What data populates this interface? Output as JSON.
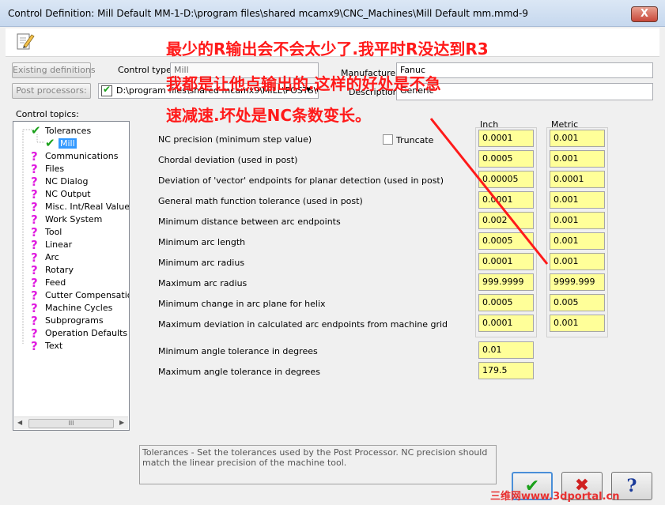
{
  "window": {
    "title": "Control Definition: Mill Default MM-1-D:\\program files\\shared mcamx9\\CNC_Machines\\Mill Default mm.mmd-9",
    "close_label": "X"
  },
  "header": {
    "existing_definitions_label": "Existing definitions",
    "post_processors_label": "Post processors:",
    "control_type_label": "Control type:",
    "control_type_value": "Mill",
    "post_path_value": "D:\\program files\\shared mcamx9\\MILL\\POSTS\\G",
    "manufacturer_label": "Manufacturer:",
    "manufacturer_value": "Fanuc",
    "description_label": "Description:",
    "description_value": "Generic"
  },
  "sidebar": {
    "title": "Control topics:",
    "items": [
      {
        "label": "Tolerances",
        "status": "check",
        "indent": 1
      },
      {
        "label": "Mill",
        "status": "check",
        "indent": 2,
        "selected": true
      },
      {
        "label": "Communications",
        "status": "question",
        "indent": 1
      },
      {
        "label": "Files",
        "status": "question",
        "indent": 1
      },
      {
        "label": "NC Dialog",
        "status": "question",
        "indent": 1
      },
      {
        "label": "NC Output",
        "status": "question",
        "indent": 1
      },
      {
        "label": "Misc. Int/Real Values",
        "status": "question",
        "indent": 1
      },
      {
        "label": "Work System",
        "status": "question",
        "indent": 1
      },
      {
        "label": "Tool",
        "status": "question",
        "indent": 1
      },
      {
        "label": "Linear",
        "status": "question",
        "indent": 1
      },
      {
        "label": "Arc",
        "status": "question",
        "indent": 1
      },
      {
        "label": "Rotary",
        "status": "question",
        "indent": 1
      },
      {
        "label": "Feed",
        "status": "question",
        "indent": 1
      },
      {
        "label": "Cutter Compensation",
        "status": "question",
        "indent": 1
      },
      {
        "label": "Machine Cycles",
        "status": "question",
        "indent": 1
      },
      {
        "label": "Subprograms",
        "status": "question",
        "indent": 1
      },
      {
        "label": "Operation Defaults",
        "status": "question",
        "indent": 1
      },
      {
        "label": "Text",
        "status": "question",
        "indent": 1
      }
    ],
    "scroll_thumb": "III"
  },
  "tolerances": {
    "inch_header": "Inch",
    "metric_header": "Metric",
    "truncate_label": "Truncate",
    "truncate_checked": false,
    "rows": [
      {
        "label": "NC precision (minimum step value)",
        "inch": "0.0001",
        "metric": "0.001"
      },
      {
        "label": "Chordal deviation (used in post)",
        "inch": "0.0005",
        "metric": "0.001"
      },
      {
        "label": "Deviation of 'vector' endpoints for planar detection  (used in post)",
        "inch": "0.00005",
        "metric": "0.0001"
      },
      {
        "label": "General math function tolerance  (used in post)",
        "inch": "0.0001",
        "metric": "0.001"
      },
      {
        "label": "Minimum distance between arc endpoints",
        "inch": "0.002",
        "metric": "0.001"
      },
      {
        "label": "Minimum arc length",
        "inch": "0.0005",
        "metric": "0.001"
      },
      {
        "label": "Minimum arc radius",
        "inch": "0.0001",
        "metric": "0.001"
      },
      {
        "label": "Maximum arc radius",
        "inch": "999.9999",
        "metric": "9999.999"
      },
      {
        "label": "Minimum change in arc plane for helix",
        "inch": "0.0005",
        "metric": "0.005"
      },
      {
        "label": "Maximum deviation in calculated arc endpoints from machine grid",
        "inch": "0.0001",
        "metric": "0.001"
      }
    ],
    "angle_rows": [
      {
        "label": "Minimum angle tolerance in degrees",
        "value": "0.01"
      },
      {
        "label": "Maximum angle tolerance in degrees",
        "value": "179.5"
      }
    ]
  },
  "help_text": "Tolerances - Set the tolerances used by the Post Processor.  NC precision should match the linear precision of the machine tool.",
  "buttons": {
    "ok_icon": "check-icon",
    "cancel_icon": "x-icon",
    "help_icon": "question-icon",
    "ok_glyph": "✔",
    "cancel_glyph": "✖",
    "help_glyph": "?"
  },
  "annotation": {
    "lines": [
      "最少的R输出会不会太少了.我平时R没达到R3",
      "我都是让他点输出的.这样的好处是不急",
      "速减速.坏处是NC条数变长。"
    ],
    "color": "#ff1a1a"
  },
  "watermark": "三维网www.3dportal.cn"
}
